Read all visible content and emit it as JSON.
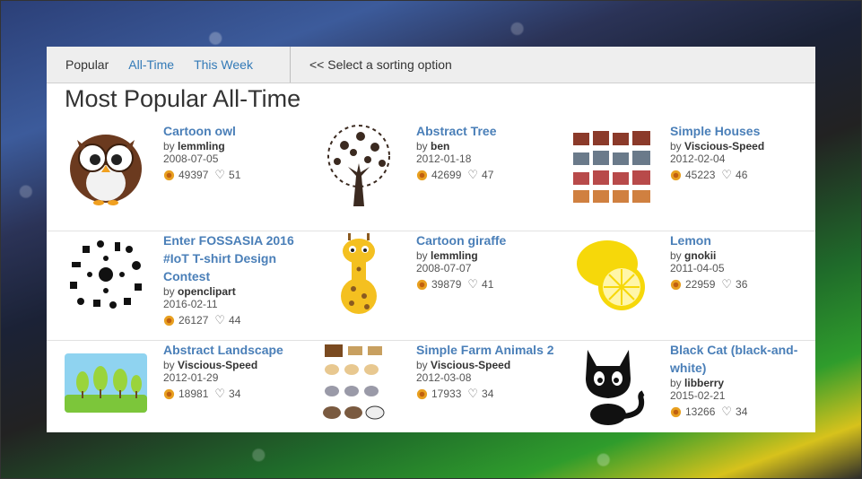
{
  "tabs": {
    "popular": "Popular",
    "all_time": "All-Time",
    "this_week": "This Week"
  },
  "sort_hint": "<< Select a sorting option",
  "heading": "Most Popular All-Time",
  "by_label": "by",
  "items": [
    {
      "title": "Cartoon owl",
      "author": "lemmling",
      "date": "2008-07-05",
      "downloads": "49397",
      "likes": "51",
      "icon": "owl-icon"
    },
    {
      "title": "Abstract Tree",
      "author": "ben",
      "date": "2012-01-18",
      "downloads": "42699",
      "likes": "47",
      "icon": "tree-icon"
    },
    {
      "title": "Simple Houses",
      "author": "Viscious-Speed",
      "date": "2012-02-04",
      "downloads": "45223",
      "likes": "46",
      "icon": "houses-icon"
    },
    {
      "title": "Enter FOSSASIA 2016 #IoT T-shirt Design Contest",
      "author": "openclipart",
      "date": "2016-02-11",
      "downloads": "26127",
      "likes": "44",
      "icon": "iot-icons-icon"
    },
    {
      "title": "Cartoon giraffe",
      "author": "lemmling",
      "date": "2008-07-07",
      "downloads": "39879",
      "likes": "41",
      "icon": "giraffe-icon"
    },
    {
      "title": "Lemon",
      "author": "gnokii",
      "date": "2011-04-05",
      "downloads": "22959",
      "likes": "36",
      "icon": "lemon-icon"
    },
    {
      "title": "Abstract Landscape",
      "author": "Viscious-Speed",
      "date": "2012-01-29",
      "downloads": "18981",
      "likes": "34",
      "icon": "landscape-icon"
    },
    {
      "title": "Simple Farm Animals 2",
      "author": "Viscious-Speed",
      "date": "2012-03-08",
      "downloads": "17933",
      "likes": "34",
      "icon": "farm-animals-icon"
    },
    {
      "title": "Black Cat (black-and-white)",
      "author": "libberry",
      "date": "2015-02-21",
      "downloads": "13266",
      "likes": "34",
      "icon": "black-cat-icon"
    }
  ],
  "colors": {
    "link": "#4a7fb8",
    "tab_link": "#337ab7",
    "download_badge": "#e8a020"
  }
}
